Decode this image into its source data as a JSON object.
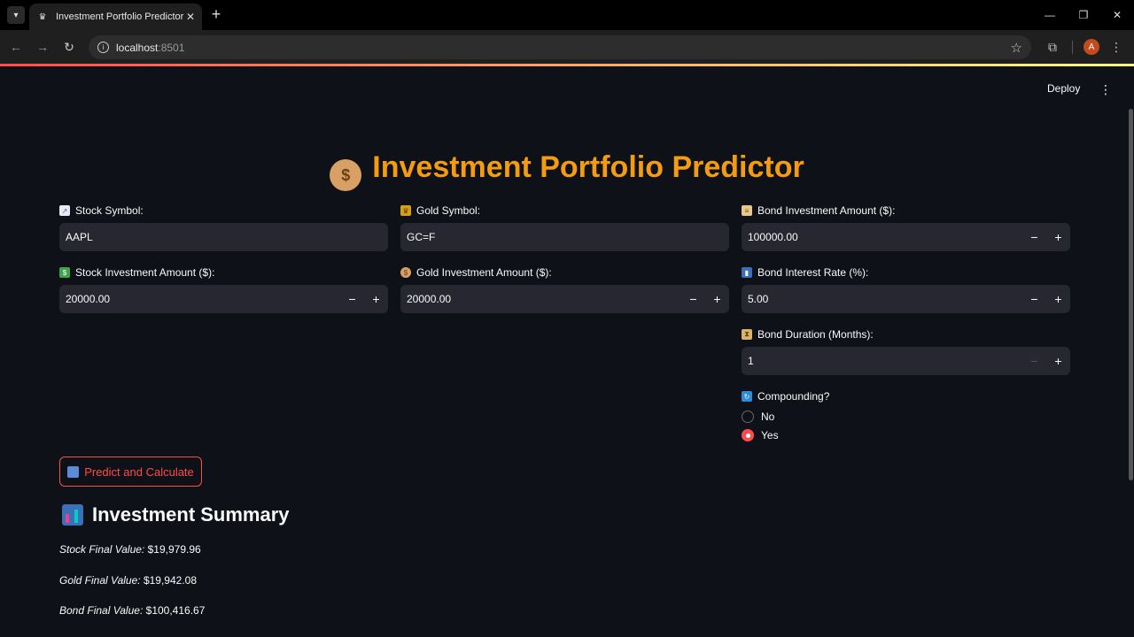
{
  "browser": {
    "tab_title": "Investment Portfolio Predictor",
    "url_host": "localhost",
    "url_port": ":8501",
    "avatar_letter": "A"
  },
  "header": {
    "deploy_label": "Deploy"
  },
  "page": {
    "title": "Investment Portfolio Predictor"
  },
  "stock": {
    "symbol_label": "Stock Symbol:",
    "symbol_value": "AAPL",
    "amount_label": "Stock Investment Amount ($):",
    "amount_value": "20000.00"
  },
  "gold": {
    "symbol_label": "Gold Symbol:",
    "symbol_value": "GC=F",
    "amount_label": "Gold Investment Amount ($):",
    "amount_value": "20000.00"
  },
  "bond": {
    "amount_label": "Bond Investment Amount ($):",
    "amount_value": "100000.00",
    "rate_label": "Bond Interest Rate (%):",
    "rate_value": "5.00",
    "duration_label": "Bond Duration (Months):",
    "duration_value": "1",
    "compounding_label": "Compounding?",
    "compounding_options": [
      "No",
      "Yes"
    ],
    "compounding_selected": "Yes"
  },
  "actions": {
    "predict_label": "Predict and Calculate"
  },
  "summary": {
    "title": "Investment Summary",
    "stock_label": "Stock Final Value:",
    "stock_value": "$19,979.96",
    "gold_label": "Gold Final Value:",
    "gold_value": "$19,942.08",
    "bond_label": "Bond Final Value:",
    "bond_value": "$100,416.67"
  },
  "colors": {
    "accent": "#ff4b4b",
    "title": "#f39c12",
    "background": "#0e1117",
    "input_bg": "#262730"
  }
}
